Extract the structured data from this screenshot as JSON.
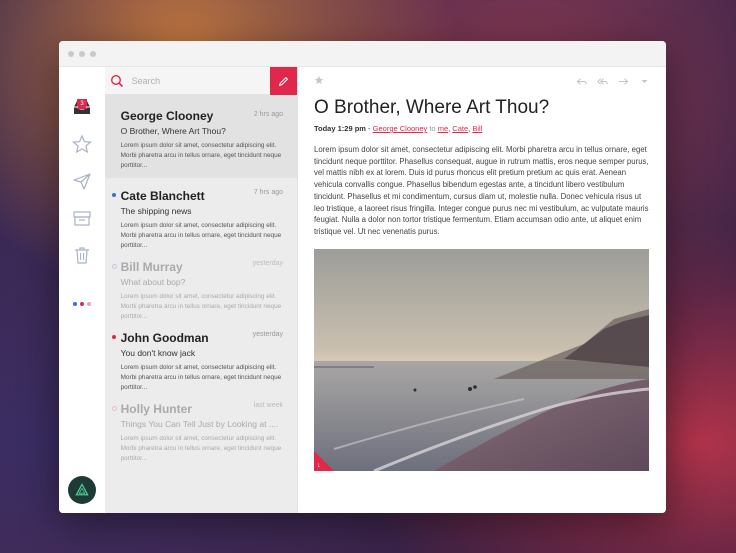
{
  "search": {
    "placeholder": "Search"
  },
  "sidebar": {
    "inbox_count": "3"
  },
  "mails": [
    {
      "sender": "George Clooney",
      "subject": "O Brother, Where Art Thou?",
      "time": "2 hrs ago",
      "preview": "Lorem ipsum dolor sit amet, consectetur adipiscing elit. Morbi pharetra arcu in tellus ornare, eget tincidunt neque porttitor..."
    },
    {
      "sender": "Cate Blanchett",
      "subject": "The shipping news",
      "time": "7 hrs ago",
      "preview": "Lorem ipsum dolor sit amet, consectetur adipiscing elit. Morbi pharetra arcu in tellus ornare, eget tincidunt neque porttitor..."
    },
    {
      "sender": "Bill Murray",
      "subject": "What about bop?",
      "time": "yesterday",
      "preview": "Lorem ipsum dolor sit amet, consectetur adipiscing elit. Morbi pharetra arcu in tellus ornare, eget tincidunt neque porttitor..."
    },
    {
      "sender": "John Goodman",
      "subject": "You don't know jack",
      "time": "yesterday",
      "preview": "Lorem ipsum dolor sit amet, consectetur adipiscing elit. Morbi pharetra arcu in tellus ornare, eget tincidunt neque porttitor..."
    },
    {
      "sender": "Holly Hunter",
      "subject": "Things You Can Tell Just by Looking at ....",
      "time": "last week",
      "preview": "Lorem ipsum dolor sit amet, consectetur adipiscing elit. Morbi pharetra arcu in tellus ornare, eget tincidunt neque porttitor..."
    }
  ],
  "reader": {
    "title": "O Brother, Where Art Thou?",
    "date": "Today 1:29 pm",
    "dash": " - ",
    "from": "George Clooney",
    "to_word": " to ",
    "recipients": [
      "me",
      "Cate",
      "Bill"
    ],
    "body": "Lorem ipsum dolor sit amet, consectetur adipiscing elit. Morbi pharetra arcu in tellus ornare, eget tincidunt neque porttitor. Phasellus consequat, augue in rutrum mattis, eros neque semper purus, vel mattis nibh ex at lorem. Duis id purus rhoncus elit pretium pretium ac quis erat. Aenean vehicula convallis congue. Phasellus bibendum egestas ante, a tincidunt libero vestibulum tincidunt. Phasellus et mi condimentum, cursus diam ut, molestie nulla. Donec vehicula risus ut leo tristique, a laoreet risus fringilla. Integer congue purus nec mi vestibulum, ac vulputate mauris feugiat. Nulla a dolor non tortor tristique fermentum. Etiam accumsan odio ante, ut aliquet enim tristique vel. Ut nec venenatis purus."
  },
  "colors": {
    "accent": "#e0284a",
    "dot_blue": "#3b6fd8",
    "dot_red": "#e0284a"
  }
}
